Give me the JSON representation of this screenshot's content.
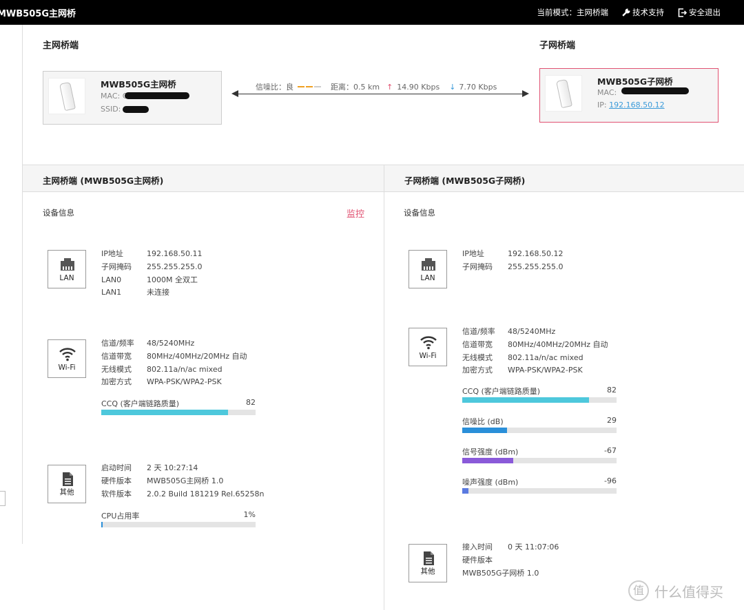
{
  "header": {
    "brand": "MWB505G主网桥",
    "mode": "当前模式：主网桥端",
    "support": "技术支持",
    "logout": "安全退出"
  },
  "topology": {
    "master_title": "主网桥端",
    "slave_title": "子网桥端",
    "master": {
      "name": "MWB505G主网桥",
      "mac_label": "MAC: ",
      "mac_value": "C",
      "ssid_label": "SSID: "
    },
    "slave": {
      "name": "MWB505G子网桥",
      "mac_label": "MAC: ",
      "mac_value": "",
      "ip_label": "IP: ",
      "ip": "192.168.50.12"
    },
    "link": {
      "snr_label": "信噪比：",
      "snr_value": "良",
      "distance_label": "距离：",
      "distance_value": "0.5 km",
      "up_rate": "14.90 Kbps",
      "down_rate": "7.70 Kbps",
      "signal_colors": [
        "#f0a020",
        "#f0a020",
        "#cccccc"
      ]
    }
  },
  "left_panel": {
    "header": "主网桥端 (MWB505G主网桥)",
    "section": "设备信息",
    "monitor": "监控",
    "lan": {
      "icon_label": "LAN",
      "rows": [
        {
          "k": "IP地址",
          "v": "192.168.50.11"
        },
        {
          "k": "子网掩码",
          "v": "255.255.255.0"
        },
        {
          "k": "LAN0",
          "v": "1000M 全双工"
        },
        {
          "k": "LAN1",
          "v": "未连接"
        }
      ]
    },
    "wifi": {
      "icon_label": "Wi-Fi",
      "rows": [
        {
          "k": "信道/频率",
          "v": "48/5240MHz"
        },
        {
          "k": "信道带宽",
          "v": "80MHz/40MHz/20MHz 自动"
        },
        {
          "k": "无线模式",
          "v": "802.11a/n/ac mixed"
        },
        {
          "k": "加密方式",
          "v": "WPA-PSK/WPA2-PSK"
        }
      ],
      "bars": [
        {
          "label": "CCQ (客户端链路质量)",
          "value": "82",
          "fraction": 0.82,
          "color": "#4ec8dc"
        }
      ]
    },
    "other": {
      "icon_label": "其他",
      "rows": [
        {
          "k": "启动时间",
          "v": "2 天 10:27:14"
        },
        {
          "k": "硬件版本",
          "v": "MWB505G主网桥 1.0"
        },
        {
          "k": "软件版本",
          "v": "2.0.2 Build 181219 Rel.65258n"
        }
      ],
      "bars": [
        {
          "label": "CPU占用率",
          "value": "1%",
          "fraction": 0.01,
          "color": "#2a8fd9"
        }
      ]
    }
  },
  "right_panel": {
    "header": "子网桥端 (MWB505G子网桥)",
    "section": "设备信息",
    "lan": {
      "icon_label": "LAN",
      "rows": [
        {
          "k": "IP地址",
          "v": "192.168.50.12"
        },
        {
          "k": "子网掩码",
          "v": "255.255.255.0"
        }
      ]
    },
    "wifi": {
      "icon_label": "Wi-Fi",
      "rows": [
        {
          "k": "信道/频率",
          "v": "48/5240MHz"
        },
        {
          "k": "信道带宽",
          "v": "80MHz/40MHz/20MHz 自动"
        },
        {
          "k": "无线模式",
          "v": "802.11a/n/ac mixed"
        },
        {
          "k": "加密方式",
          "v": "WPA-PSK/WPA2-PSK"
        }
      ],
      "bars": [
        {
          "label": "CCQ (客户端链路质量)",
          "value": "82",
          "fraction": 0.82,
          "color": "#4ec8dc"
        },
        {
          "label": "信噪比 (dB)",
          "value": "29",
          "fraction": 0.29,
          "color": "#2a8fd9"
        },
        {
          "label": "信号强度 (dBm)",
          "value": "-67",
          "fraction": 0.33,
          "color": "#8a5ad9"
        },
        {
          "label": "噪声强度 (dBm)",
          "value": "-96",
          "fraction": 0.04,
          "color": "#5a7ae0"
        }
      ]
    },
    "other": {
      "icon_label": "其他",
      "rows": [
        {
          "k": "接入时间",
          "v": "0 天 11:07:06"
        },
        {
          "k": "硬件版本",
          "v": ""
        },
        {
          "k": "MWB505G子网桥 1.0",
          "v": ""
        }
      ]
    }
  },
  "watermark": {
    "glyph": "值",
    "text": "什么值得买"
  }
}
